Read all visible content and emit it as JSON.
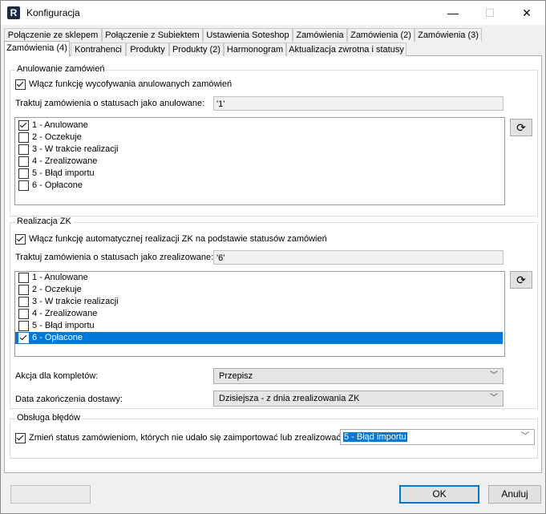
{
  "window": {
    "title": "Konfiguracja",
    "icon_letter": "R",
    "minimize": "—",
    "maximize": "☐",
    "close": "✕"
  },
  "tabs_row1": [
    "Połączenie ze sklepem",
    "Połączenie z Subiektem",
    "Ustawienia Soteshop",
    "Zamówienia",
    "Zamówienia (2)",
    "Zamówienia (3)"
  ],
  "tabs_row2": [
    "Zamówienia (4)",
    "Kontrahenci",
    "Produkty",
    "Produkty (2)",
    "Harmonogram",
    "Aktualizacja zwrotna i statusy"
  ],
  "active_tab": "Zamówienia (4)",
  "cancel_group": {
    "legend": "Anulowanie zamówień",
    "enable_label": "Włącz funkcję wycofywania anulowanych zamówień",
    "enable_checked": true,
    "status_label": "Traktuj zamówienia o statusach jako anulowane:",
    "status_value": "'1'",
    "items": [
      {
        "label": "1 - Anulowane",
        "checked": true
      },
      {
        "label": "2 - Oczekuje",
        "checked": false
      },
      {
        "label": "3 - W trakcie realizacji",
        "checked": false
      },
      {
        "label": "4 - Zrealizowane",
        "checked": false
      },
      {
        "label": "5 - Błąd importu",
        "checked": false
      },
      {
        "label": "6 - Opłacone",
        "checked": false
      }
    ],
    "refresh_icon": "refresh-icon"
  },
  "zk_group": {
    "legend": "Realizacja ZK",
    "enable_label": "Włącz funkcję automatycznej realizacji ZK na podstawie statusów zamówień",
    "enable_checked": true,
    "status_label": "Traktuj zamówienia o statusach jako zrealizowane:",
    "status_value": "'6'",
    "items": [
      {
        "label": "1 - Anulowane",
        "checked": false
      },
      {
        "label": "2 - Oczekuje",
        "checked": false
      },
      {
        "label": "3 - W trakcie realizacji",
        "checked": false
      },
      {
        "label": "4 - Zrealizowane",
        "checked": false
      },
      {
        "label": "5 - Błąd importu",
        "checked": false
      },
      {
        "label": "6 - Opłacone",
        "checked": true,
        "selected": true
      }
    ],
    "kit_action_label": "Akcja dla kompletów:",
    "kit_action_value": "Przepisz",
    "delivery_label": "Data zakończenia dostawy:",
    "delivery_value": "Dzisiejsza - z dnia zrealizowania ZK"
  },
  "error_group": {
    "legend": "Obsługa błędów",
    "change_label": "Zmień status zamówieniom, których nie udało się zaimportować lub zrealizować:",
    "change_checked": true,
    "change_value": "5 - Błąd importu"
  },
  "buttons": {
    "ok": "OK",
    "cancel": "Anuluj",
    "extra": ""
  },
  "colors": {
    "selection": "#0078d7"
  }
}
